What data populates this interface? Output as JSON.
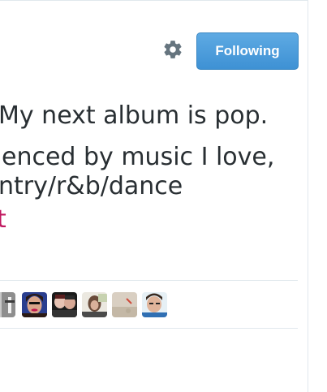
{
  "header": {
    "settings_icon": "gear-icon",
    "follow_button_label": "Following",
    "follow_button_color": "#4aa1e0"
  },
  "tweet": {
    "lines": [
      "My next album is pop.",
      "enced by music I love,",
      "ntry/r&b/dance"
    ],
    "link_text": "t",
    "link_color": "#c0185f"
  },
  "favorited_by": {
    "avatars": [
      "avatar-user",
      "avatar-user",
      "avatar-user",
      "avatar-user",
      "avatar-user",
      "avatar-user"
    ]
  }
}
